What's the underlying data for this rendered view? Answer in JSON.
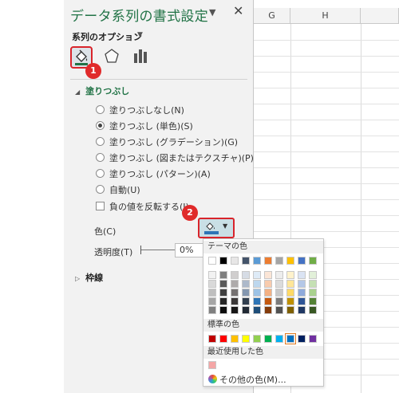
{
  "sheet": {
    "columns": [
      "G",
      "H"
    ]
  },
  "pane": {
    "title": "データ系列の書式設定",
    "close_glyph": "✕",
    "series_options_label": "系列のオプション"
  },
  "badges": {
    "one": "1",
    "two": "2"
  },
  "fill": {
    "section_label": "塗りつぶし",
    "options": [
      {
        "label": "塗りつぶしなし(N)",
        "selected": false
      },
      {
        "label": "塗りつぶし (単色)(S)",
        "selected": true
      },
      {
        "label": "塗りつぶし (グラデーション)(G)",
        "selected": false
      },
      {
        "label": "塗りつぶし (図またはテクスチャ)(P)",
        "selected": false
      },
      {
        "label": "塗りつぶし (パターン)(A)",
        "selected": false
      },
      {
        "label": "自動(U)",
        "selected": false
      }
    ],
    "invert_label": "負の値を反転する(I)",
    "color_label": "色(C)",
    "transparency_label": "透明度(T)",
    "transparency_value": "0%"
  },
  "border": {
    "section_label": "枠線"
  },
  "palette": {
    "theme_colors_label": "テーマの色",
    "standard_colors_label": "標準の色",
    "recent_colors_label": "最近使用した色",
    "more_colors_label": "その他の色(M)...",
    "theme_top": [
      "#ffffff",
      "#000000",
      "#e7e6e6",
      "#44546a",
      "#5b9bd5",
      "#ed7d31",
      "#a5a5a5",
      "#ffc000",
      "#4472c4",
      "#70ad47"
    ],
    "theme_shades": [
      [
        "#f2f2f2",
        "#7f7f7f",
        "#d0cece",
        "#d6dce5",
        "#deebf7",
        "#fbe5d6",
        "#ededed",
        "#fff2cc",
        "#dae3f3",
        "#e2f0d9"
      ],
      [
        "#d9d9d9",
        "#595959",
        "#aeabab",
        "#adb9ca",
        "#bdd7ee",
        "#f8cbad",
        "#dbdbdb",
        "#ffe699",
        "#b4c7e7",
        "#c5e0b4"
      ],
      [
        "#bfbfbf",
        "#404040",
        "#757171",
        "#8497b0",
        "#9dc3e6",
        "#f4b183",
        "#c9c9c9",
        "#ffd966",
        "#8faadc",
        "#a9d18e"
      ],
      [
        "#a6a6a6",
        "#262626",
        "#3b3838",
        "#323f4f",
        "#2e75b6",
        "#c55a11",
        "#7b7b7b",
        "#bf9000",
        "#2f5597",
        "#548235"
      ],
      [
        "#808080",
        "#0d0d0d",
        "#171616",
        "#222a35",
        "#1f4e79",
        "#843c0c",
        "#525252",
        "#7f6000",
        "#203864",
        "#385723"
      ]
    ],
    "standard": [
      "#c00000",
      "#ff0000",
      "#ffc000",
      "#ffff00",
      "#92d050",
      "#00b050",
      "#00b0f0",
      "#0070c0",
      "#002060",
      "#7030a0"
    ],
    "standard_selected_index": 7,
    "recent": [
      "#f4a6a6"
    ]
  }
}
